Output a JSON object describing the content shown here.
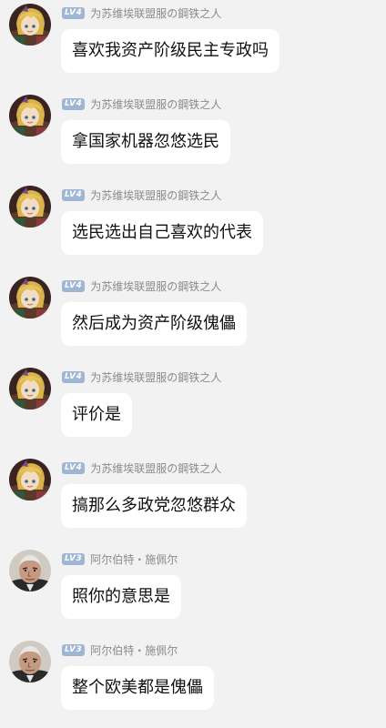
{
  "messages": [
    {
      "level": "LV4",
      "name": "为苏维埃联盟服の鋼铁之人",
      "text": "喜欢我资产阶级民主专政吗",
      "avatar": "anime-girl-avatar"
    },
    {
      "level": "LV4",
      "name": "为苏维埃联盟服の鋼铁之人",
      "text": "拿国家机器忽悠选民",
      "avatar": "anime-girl-avatar"
    },
    {
      "level": "LV4",
      "name": "为苏维埃联盟服の鋼铁之人",
      "text": "选民选出自己喜欢的代表",
      "avatar": "anime-girl-avatar"
    },
    {
      "level": "LV4",
      "name": "为苏维埃联盟服の鋼铁之人",
      "text": "然后成为资产阶级傀儡",
      "avatar": "anime-girl-avatar"
    },
    {
      "level": "LV4",
      "name": "为苏维埃联盟服の鋼铁之人",
      "text": "评价是",
      "avatar": "anime-girl-avatar"
    },
    {
      "level": "LV4",
      "name": "为苏维埃联盟服の鋼铁之人",
      "text": "搞那么多政党忽悠群众",
      "avatar": "anime-girl-avatar"
    },
    {
      "level": "LV3",
      "name": "阿尔伯特・施佩尔",
      "text": "照你的意思是",
      "avatar": "old-man-avatar"
    },
    {
      "level": "LV3",
      "name": "阿尔伯特・施佩尔",
      "text": "整个欧美都是傀儡",
      "avatar": "old-man-avatar"
    }
  ],
  "colors": {
    "background": "#f2f2f2",
    "bubble": "#ffffff",
    "level_badge": "#9fb6d3",
    "name_text": "#8a8a8a"
  }
}
